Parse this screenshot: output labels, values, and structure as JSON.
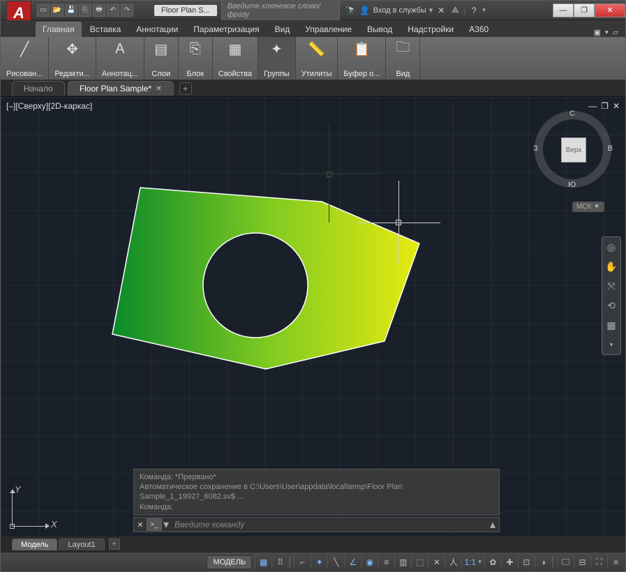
{
  "app": {
    "logo_letter": "A",
    "title_doc": "Floor Plan S...",
    "search_placeholder": "Введите ключевое слово/фразу",
    "login_label": "Вход в службы"
  },
  "win": {
    "min": "—",
    "max": "❐",
    "close": "✕"
  },
  "ribbon_tabs": {
    "items": [
      "Главная",
      "Вставка",
      "Аннотации",
      "Параметризация",
      "Вид",
      "Управление",
      "Вывод",
      "Надстройки",
      "A360"
    ],
    "active_index": 0
  },
  "ribbon_panels": [
    {
      "label": "Рисован...",
      "icon": "╱"
    },
    {
      "label": "Редакти...",
      "icon": "✥"
    },
    {
      "label": "Аннотац...",
      "icon": "A"
    },
    {
      "label": "Слои",
      "icon": "▤"
    },
    {
      "label": "Блок",
      "icon": "⎘"
    },
    {
      "label": "Свойства",
      "icon": "▦"
    },
    {
      "label": "Группы",
      "icon": "✦"
    },
    {
      "label": "Утилиты",
      "icon": "📏"
    },
    {
      "label": "Буфер о...",
      "icon": "📋"
    },
    {
      "label": "Вид",
      "icon": "🗀"
    }
  ],
  "file_tabs": {
    "start": "Начало",
    "items": [
      "Floor Plan Sample*"
    ],
    "active_index": 0
  },
  "viewport": {
    "label": "[–][Сверху][2D-каркас]"
  },
  "viewcube": {
    "face": "Верх",
    "n": "С",
    "s": "Ю",
    "w": "З",
    "e": "В"
  },
  "ucs_badge": "МСК ▼",
  "ucs_axes": {
    "x": "X",
    "y": "Y"
  },
  "command": {
    "history": [
      "Команда: *Прервано*",
      "Автоматическое сохранение в C:\\Users\\User\\appdata\\local\\temp\\Floor Plan Sample_1_19927_6082.sv$ ...",
      "Команда:"
    ],
    "prompt_icon": ">_",
    "placeholder": "Введите команду"
  },
  "layout_tabs": {
    "items": [
      "Модель",
      "Layout1"
    ],
    "active_index": 0
  },
  "status": {
    "model": "МОДЕЛЬ",
    "scale": "1:1"
  }
}
